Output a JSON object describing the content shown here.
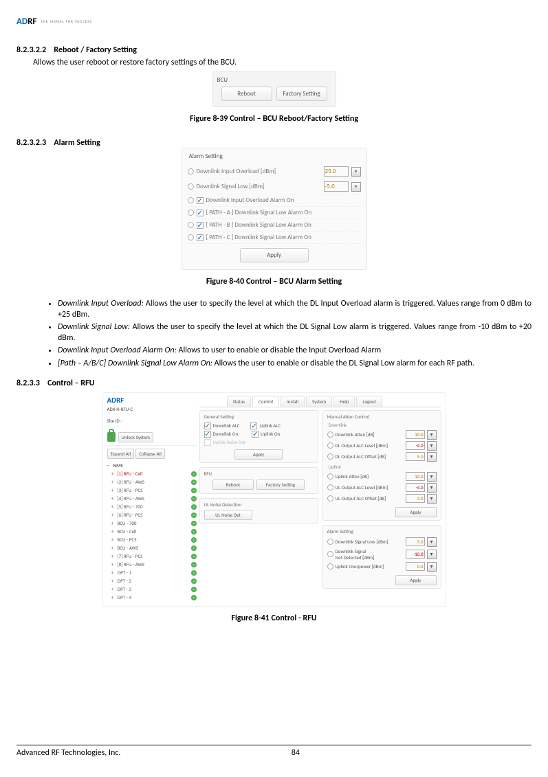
{
  "logo": {
    "brand_a": "AD",
    "brand_b": "RF",
    "tagline": "THE SIGNAL FOR SUCCESS"
  },
  "sec82322": {
    "num": "8.2.3.2.2",
    "title": "Reboot / Factory Setting",
    "body": "Allows the user reboot or restore factory settings of the BCU."
  },
  "bcu": {
    "label": "BCU",
    "reboot": "Reboot",
    "factory": "Factory Setting"
  },
  "cap839": "Figure 8-39    Control – BCU Reboot/Factory Setting",
  "sec82323": {
    "num": "8.2.3.2.3",
    "title": "Alarm Setting"
  },
  "alarm": {
    "title": "Alarm Setting",
    "dl_in_ov": "Downlink Input Overload [dBm]",
    "dl_in_ov_val": "25.0",
    "dl_sig_low": "Downlink Signal Low [dBm]",
    "dl_sig_low_val": "-5.0",
    "chk1": "Downlink Input Overload Alarm On",
    "chk2": "[ PATH - A ] Downlink Signal Low Alarm On",
    "chk3": "[ PATH - B ] Downlink Signal Low Alarm On",
    "chk4": "[ PATH - C ] Downlink Signal Low Alarm On",
    "apply": "Apply"
  },
  "cap840": "Figure 8-40    Control – BCU Alarm Setting",
  "bullets": {
    "b1_em": "Downlink Input Overload:",
    "b1_rest": " Allows the user to specify the level at which the DL Input Overload alarm is triggered.  Values range from 0 dBm to +25 dBm.",
    "b2_em": "Downlink Signal Low:",
    "b2_rest": " Allows the user to specify the level at which the DL Signal Low alarm is triggered.  Values range from -10 dBm to +20 dBm.",
    "b3_em": "Downlink Input Overload Alarm On:",
    "b3_rest": " Allows to user to enable or disable the Input Overload Alarm",
    "b4_em": "[Path – A/B/C] Downlink Signal Low Alarm On:",
    "b4_rest": " Allows the user to enable or disable the DL Signal Low alarm for each RF path."
  },
  "sec8233": {
    "num": "8.2.3.3",
    "title": "Control – RFU"
  },
  "rfu": {
    "logo": "ADRF",
    "site1": "ADX-H-RFU-C",
    "site2": "Site ID :",
    "unlock": "Unlock System",
    "expand": "Expand All",
    "collapse": "Collapse All",
    "tree": {
      "nms": "NMS",
      "items": [
        {
          "t": "[1] RFU - Cell",
          "cls": "red"
        },
        {
          "t": "[2] RFU - AWS"
        },
        {
          "t": "[3] RFU - PCS"
        },
        {
          "t": "[4] RFU - AWS"
        },
        {
          "t": "[5] RFU - 700"
        },
        {
          "t": "[6] RFU - PCS"
        },
        {
          "t": "BCU - 700"
        },
        {
          "t": "BCU - Cell"
        },
        {
          "t": "BCU - PCS"
        },
        {
          "t": "BCU - AWS"
        },
        {
          "t": "[7] RFU - PCS"
        },
        {
          "t": "[8] RFU - AWS"
        },
        {
          "t": "OPT - 1"
        },
        {
          "t": "OPT - 2"
        },
        {
          "t": "OPT - 3"
        },
        {
          "t": "OPT - 4"
        }
      ]
    },
    "tabs": {
      "status": "Status",
      "control": "Control",
      "install": "Install",
      "system": "System",
      "help": "Help",
      "logout": "Logout"
    },
    "gen": {
      "title": "General Setting",
      "dl_alc": "Downlink ALC",
      "ul_alc": "Uplink ALC",
      "dl_on": "Downlink On",
      "ul_on": "Uplink On",
      "ul_noise": "Uplink Noise Det",
      "apply": "Apply"
    },
    "rfu_p": {
      "title": "RFU",
      "reboot": "Reboot",
      "factory": "Factory Setting"
    },
    "ulnd": {
      "title": "UL Noise Detection",
      "btn": "UL Noise Det"
    },
    "man": {
      "title": "Manual Atten Control",
      "dl": "Downlink",
      "ul": "Uplink",
      "dl_att": "Downlink Atten [dB]",
      "dl_att_v": "10.0",
      "dl_alc_l": "DL Output ALC Level [dBm]",
      "dl_alc_l_v": "-4.0",
      "dl_alc_o": "DL Output ALC Offset [dB]",
      "dl_alc_o_v": "5.0",
      "ul_att": "Uplink Atten [dB]",
      "ul_att_v": "10.0",
      "ul_alc_l": "UL Output ALC Level [dBm]",
      "ul_alc_l_v": "-4.0",
      "ul_alc_o": "UL Output ALC Offset [dB]",
      "ul_alc_o_v": "3.0",
      "apply": "Apply"
    },
    "al": {
      "title": "Alarm Setting",
      "sig_low": "Downlink Signal Low [dBm]",
      "sig_low_v": "5.0",
      "not_det": "Downlink Signal\nNot Detected [dBm]",
      "not_det_v": "-10.0",
      "ul_ov": "Uplink Overpower [dBm]",
      "ul_ov_v": "0.0",
      "apply": "Apply"
    }
  },
  "cap841": "Figure 8-41    Control - RFU",
  "footer": {
    "company": "Advanced RF Technologies, Inc.",
    "page": "84"
  }
}
